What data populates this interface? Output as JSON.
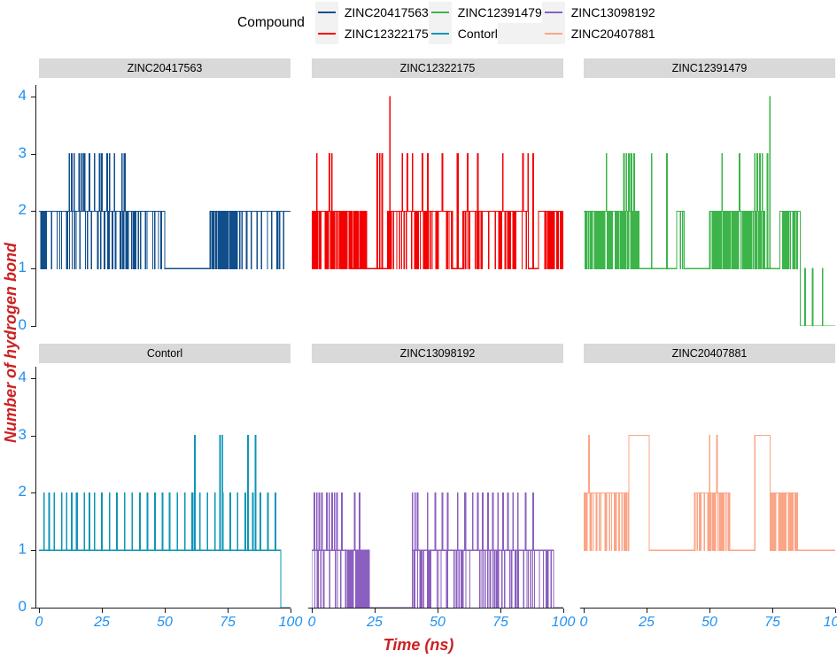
{
  "legend": {
    "title": "Compound",
    "entries": [
      {
        "label": "ZINC20417563",
        "color": "#114E8C"
      },
      {
        "label": "ZINC12322175",
        "color": "#F40000"
      },
      {
        "label": "ZINC12391479",
        "color": "#3CB44A"
      },
      {
        "label": "Contorl",
        "color": "#0D95B8"
      },
      {
        "label": "ZINC13098192",
        "color": "#8B5FBF"
      },
      {
        "label": "ZINC20407881",
        "color": "#FBA587"
      }
    ],
    "columns": [
      [
        "ZINC20417563",
        "ZINC12322175"
      ],
      [
        "ZINC12391479",
        "Contorl"
      ],
      [
        "ZINC13098192",
        "ZINC20407881"
      ]
    ]
  },
  "axes": {
    "ylabel": "Number of hydrogen bond",
    "xlabel": "Time (ns)",
    "yticks": [
      "0",
      "1",
      "2",
      "3",
      "4"
    ],
    "xticks": [
      "0",
      "25",
      "50",
      "75",
      "100"
    ],
    "ytick_color": "#1f90f0",
    "xtick_color": "#1f90f0",
    "label_color": "#cc2222"
  },
  "strips": [
    "ZINC20417563",
    "ZINC12322175",
    "ZINC12391479",
    "Contorl",
    "ZINC13098192",
    "ZINC20407881"
  ],
  "chart_data": {
    "type": "line",
    "title": "",
    "xlabel": "Time (ns)",
    "ylabel": "Number of hydrogen bond",
    "xlim": [
      0,
      100
    ],
    "ylim": [
      0,
      4.2
    ],
    "xticks": [
      0,
      25,
      50,
      75,
      100
    ],
    "yticks": [
      0,
      1,
      2,
      3,
      4
    ],
    "grid": false,
    "legend_position": "top",
    "legend_title": "Compound",
    "facet": {
      "rows": 2,
      "cols": 3,
      "strip_position": "top"
    },
    "note": "Six faceted step/line traces of hydrogen-bond count vs simulation time (0-100 ns). Traces are high-frequency square steps between integer counts, rendered dense enough to appear as filled blocks.",
    "series": [
      {
        "name": "ZINC20417563",
        "color": "#114E8C",
        "facet": "ZINC20417563",
        "seed": 101,
        "baseline_segments": [
          {
            "t0": 0,
            "t1": 50,
            "level": 2,
            "dip": 1,
            "dip_rate": 0.1
          },
          {
            "t0": 50,
            "t1": 68,
            "level": 1,
            "dip": 1,
            "dip_rate": 0.02
          },
          {
            "t0": 68,
            "t1": 79,
            "level": 2,
            "dip": 1,
            "dip_rate": 0.42
          },
          {
            "t0": 79,
            "t1": 100,
            "level": 2,
            "dip": 1,
            "dip_rate": 0.05
          }
        ],
        "floor": 0,
        "floor_from": 0,
        "spikes_to_3": [
          12,
          13,
          14,
          16,
          17,
          18,
          20,
          22,
          24,
          25,
          27,
          28,
          30,
          33,
          34
        ],
        "spikes_to_4": [],
        "mean": 1.95,
        "max": 3,
        "min": 1
      },
      {
        "name": "ZINC12322175",
        "color": "#F40000",
        "facet": "ZINC12322175",
        "seed": 202,
        "baseline_segments": [
          {
            "t0": 0,
            "t1": 12,
            "level": 2,
            "dip": 1,
            "dip_rate": 0.3
          },
          {
            "t0": 12,
            "t1": 22,
            "level": 2,
            "dip": 1,
            "dip_rate": 0.45
          },
          {
            "t0": 22,
            "t1": 30,
            "level": 1,
            "dip": 1,
            "dip_rate": 0.05
          },
          {
            "t0": 30,
            "t1": 56,
            "level": 2,
            "dip": 1,
            "dip_rate": 0.12
          },
          {
            "t0": 56,
            "t1": 60,
            "level": 1,
            "dip": 1,
            "dip_rate": 0.05
          },
          {
            "t0": 60,
            "t1": 86,
            "level": 2,
            "dip": 1,
            "dip_rate": 0.1
          },
          {
            "t0": 86,
            "t1": 90,
            "level": 1,
            "dip": 1,
            "dip_rate": 0.05
          },
          {
            "t0": 90,
            "t1": 100,
            "level": 2,
            "dip": 1,
            "dip_rate": 0.18
          }
        ],
        "floor": 0,
        "floor_from": 0,
        "spikes_to_3": [
          2,
          7,
          8,
          26,
          27,
          28,
          36,
          38,
          40,
          44,
          46,
          52,
          58,
          62,
          66,
          76,
          84,
          86,
          88
        ],
        "spikes_to_4": [
          31
        ],
        "mean": 2.1,
        "max": 4,
        "min": 0
      },
      {
        "name": "ZINC12391479",
        "color": "#3CB44A",
        "facet": "ZINC12391479",
        "seed": 303,
        "baseline_segments": [
          {
            "t0": 0,
            "t1": 22,
            "level": 2,
            "dip": 1,
            "dip_rate": 0.3
          },
          {
            "t0": 22,
            "t1": 37,
            "level": 1,
            "dip": 1,
            "dip_rate": 0.18
          },
          {
            "t0": 37,
            "t1": 40,
            "level": 2,
            "dip": 1,
            "dip_rate": 0.2
          },
          {
            "t0": 40,
            "t1": 50,
            "level": 1,
            "dip": 1,
            "dip_rate": 0.12
          },
          {
            "t0": 50,
            "t1": 72,
            "level": 2,
            "dip": 1,
            "dip_rate": 0.35
          },
          {
            "t0": 72,
            "t1": 78,
            "level": 1,
            "dip": 1,
            "dip_rate": 0.1
          },
          {
            "t0": 78,
            "t1": 86,
            "level": 2,
            "dip": 1,
            "dip_rate": 0.2
          },
          {
            "t0": 86,
            "t1": 100,
            "level": 0,
            "dip": 0,
            "dip_rate": 0.0
          }
        ],
        "floor": 0,
        "floor_from": 0,
        "spikes_to_3": [
          9,
          16,
          17,
          18,
          19,
          20,
          27,
          33,
          55,
          62,
          68,
          69,
          70,
          71,
          73
        ],
        "spikes_to_4": [
          74
        ],
        "tail_spikes_to_1": [
          88,
          91,
          95
        ],
        "mean": 1.7,
        "max": 4,
        "min": 0
      },
      {
        "name": "Contorl",
        "color": "#0D95B8",
        "facet": "Contorl",
        "seed": 404,
        "baseline_segments": [
          {
            "t0": 0,
            "t1": 96,
            "level": 1,
            "dip": 1,
            "dip_rate": 0.0
          }
        ],
        "floor": 0,
        "floor_from": 96,
        "spikes_to_2": [
          2,
          4,
          6,
          9,
          11,
          13,
          15,
          18,
          20,
          22,
          25,
          28,
          31,
          34,
          37,
          40,
          43,
          46,
          49,
          52,
          55,
          58,
          61,
          64,
          67,
          70,
          73,
          76,
          79,
          82,
          85,
          88,
          91,
          94
        ],
        "spikes_to_3": [
          62,
          72,
          73,
          83,
          86
        ],
        "mean": 1.2,
        "max": 3,
        "min": 0
      },
      {
        "name": "ZINC13098192",
        "color": "#8B5FBF",
        "facet": "ZINC13098192",
        "seed": 505,
        "baseline_segments": [
          {
            "t0": 0,
            "t1": 14,
            "level": 1,
            "dip": 0,
            "dip_rate": 0.08
          },
          {
            "t0": 14,
            "t1": 23,
            "level": 1,
            "dip": 0,
            "dip_rate": 0.3
          },
          {
            "t0": 23,
            "t1": 40,
            "level": 0,
            "dip": 0,
            "dip_rate": 0.0
          },
          {
            "t0": 40,
            "t1": 96,
            "level": 1,
            "dip": 0,
            "dip_rate": 0.1
          },
          {
            "t0": 96,
            "t1": 100,
            "level": 0,
            "dip": 0,
            "dip_rate": 0.0
          }
        ],
        "floor": 0,
        "floor_from": 96,
        "spikes_to_2": [
          1,
          2,
          3,
          4,
          6,
          7,
          8,
          9,
          10,
          12,
          17,
          19,
          25,
          27,
          33,
          40,
          41,
          42,
          46,
          49,
          52,
          54,
          58,
          61,
          64,
          66,
          68,
          70,
          72,
          74,
          76,
          78,
          80,
          82,
          85,
          88
        ],
        "spikes_to_3": [],
        "mean": 0.95,
        "max": 2,
        "min": 0
      },
      {
        "name": "ZINC20407881",
        "color": "#FBA587",
        "facet": "ZINC20407881",
        "seed": 606,
        "baseline_segments": [
          {
            "t0": 0,
            "t1": 18,
            "level": 2,
            "dip": 1,
            "dip_rate": 0.15
          },
          {
            "t0": 18,
            "t1": 21,
            "level": 3,
            "dip": 2,
            "dip_rate": 0.0
          },
          {
            "t0": 21,
            "t1": 26,
            "level": 3,
            "dip": 2,
            "dip_rate": 0.0
          },
          {
            "t0": 26,
            "t1": 44,
            "level": 1,
            "dip": 1,
            "dip_rate": 0.1
          },
          {
            "t0": 44,
            "t1": 58,
            "level": 2,
            "dip": 1,
            "dip_rate": 0.15
          },
          {
            "t0": 58,
            "t1": 68,
            "level": 1,
            "dip": 1,
            "dip_rate": 0.05
          },
          {
            "t0": 68,
            "t1": 74,
            "level": 3,
            "dip": 2,
            "dip_rate": 0.0
          },
          {
            "t0": 74,
            "t1": 85,
            "level": 2,
            "dip": 1,
            "dip_rate": 0.3
          },
          {
            "t0": 85,
            "t1": 100,
            "level": 1,
            "dip": 1,
            "dip_rate": 0.08
          }
        ],
        "floor": 0,
        "floor_from": 0,
        "spikes_to_3": [
          2,
          50,
          53
        ],
        "spikes_to_4": [],
        "mean": 1.8,
        "max": 3,
        "min": 1
      }
    ]
  }
}
